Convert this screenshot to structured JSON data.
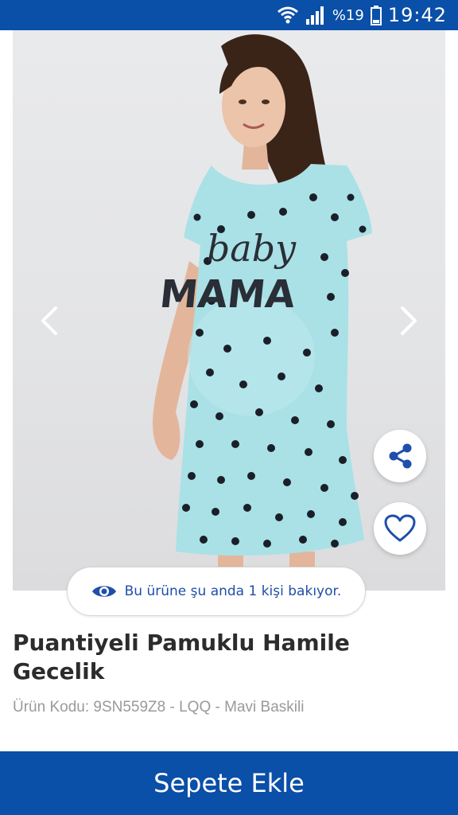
{
  "status_bar": {
    "battery": "%19",
    "time": "19:42",
    "icons": [
      "wifi-icon",
      "signal-icon",
      "battery-icon"
    ]
  },
  "gallery": {
    "prev_icon": "chevron-left-icon",
    "next_icon": "chevron-right-icon",
    "print_line1": "baby",
    "print_line2": "MAMA"
  },
  "actions": {
    "share_icon": "share-icon",
    "favorite_icon": "heart-icon"
  },
  "viewers": {
    "icon": "eye-icon",
    "text": "Bu ürüne şu anda 1 kişi bakıyor."
  },
  "product": {
    "title": "Puantiyeli Pamuklu Hamile Gecelik",
    "code": "Ürün Kodu: 9SN559Z8 - LQQ - Mavi Baskili"
  },
  "cart": {
    "label": "Sepete Ekle"
  },
  "colors": {
    "primary": "#0a4fa8",
    "dress": "#a9e1e6",
    "dots": "#1b1f2a",
    "viewer_text": "#1f4fa8"
  }
}
